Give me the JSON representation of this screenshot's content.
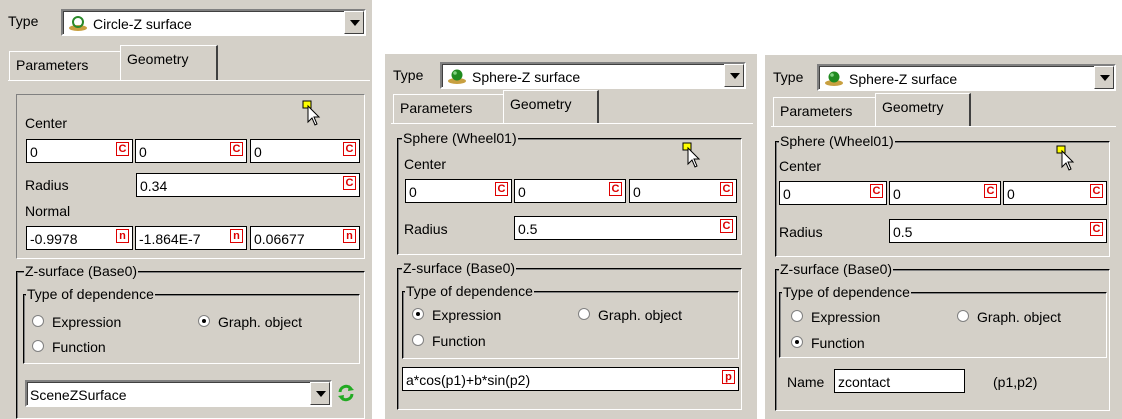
{
  "panels": [
    {
      "type_label": "Type",
      "type_value": "Circle-Z surface",
      "tabs": [
        "Parameters",
        "Geometry"
      ],
      "center_label": "Center",
      "center": [
        "0",
        "0",
        "0"
      ],
      "radius_label": "Radius",
      "radius": "0.34",
      "normal_label": "Normal",
      "normal": [
        "-0.9978",
        "-1.864E-7",
        "0.06677"
      ],
      "zsurface_title": "Z-surface (Base0)",
      "dependence_title": "Type of dependence",
      "opt_expression": "Expression",
      "opt_graph": "Graph. object",
      "opt_function": "Function",
      "selected": "graph",
      "graph_object_value": "SceneZSurface"
    },
    {
      "type_label": "Type",
      "type_value": "Sphere-Z surface",
      "tabs": [
        "Parameters",
        "Geometry"
      ],
      "sphere_title": "Sphere (Wheel01)",
      "center_label": "Center",
      "center": [
        "0",
        "0",
        "0"
      ],
      "radius_label": "Radius",
      "radius": "0.5",
      "zsurface_title": "Z-surface (Base0)",
      "dependence_title": "Type of dependence",
      "opt_expression": "Expression",
      "opt_graph": "Graph. object",
      "opt_function": "Function",
      "selected": "expression",
      "expression_value": "a*cos(p1)+b*sin(p2)"
    },
    {
      "type_label": "Type",
      "type_value": "Sphere-Z surface",
      "tabs": [
        "Parameters",
        "Geometry"
      ],
      "sphere_title": "Sphere (Wheel01)",
      "center_label": "Center",
      "center": [
        "0",
        "0",
        "0"
      ],
      "radius_label": "Radius",
      "radius": "0.5",
      "zsurface_title": "Z-surface (Base0)",
      "dependence_title": "Type of dependence",
      "opt_expression": "Expression",
      "opt_graph": "Graph. object",
      "opt_function": "Function",
      "selected": "function",
      "name_label": "Name",
      "function_name": "zcontact",
      "function_args": "(p1,p2)"
    }
  ],
  "flags": {
    "c": "C",
    "n": "n",
    "p": "p"
  },
  "colors": {
    "flag": "#dd0000",
    "refresh": "#22aa22",
    "panel": "#d4d0c8"
  }
}
